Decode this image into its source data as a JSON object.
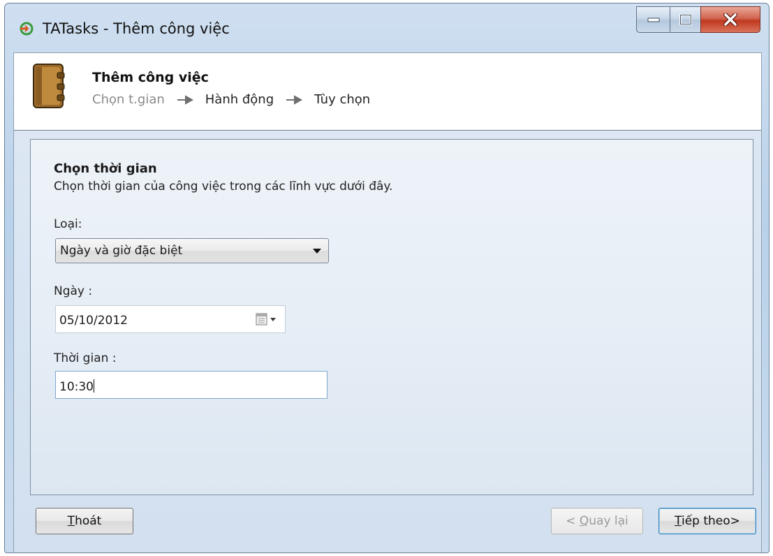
{
  "window": {
    "title": "TATasks - Thêm công việc"
  },
  "header": {
    "title": "Thêm công việc",
    "breadcrumb": [
      "Chọn t.gian",
      "Hành động",
      "Tùy chọn"
    ]
  },
  "section": {
    "title": "Chọn thời gian",
    "description": "Chọn thời gian của công việc trong các lĩnh vực dưới đây."
  },
  "fields": {
    "type_label": "Loại:",
    "type_value": "Ngày và giờ đặc biệt",
    "date_label": "Ngày :",
    "date_value": "05/10/2012",
    "time_label": "Thời gian :",
    "time_value": "10:30"
  },
  "buttons": {
    "exit_mnemonic": "T",
    "exit_rest": "hoát",
    "back_prefix": "< ",
    "back_mnemonic": "Q",
    "back_rest": "uay lại",
    "next_mnemonic": "T",
    "next_rest": "iếp theo>"
  },
  "icons": {
    "app": "tatasks-app-icon",
    "header": "notebook-icon",
    "date_picker": "calendar-dropdown-icon"
  }
}
